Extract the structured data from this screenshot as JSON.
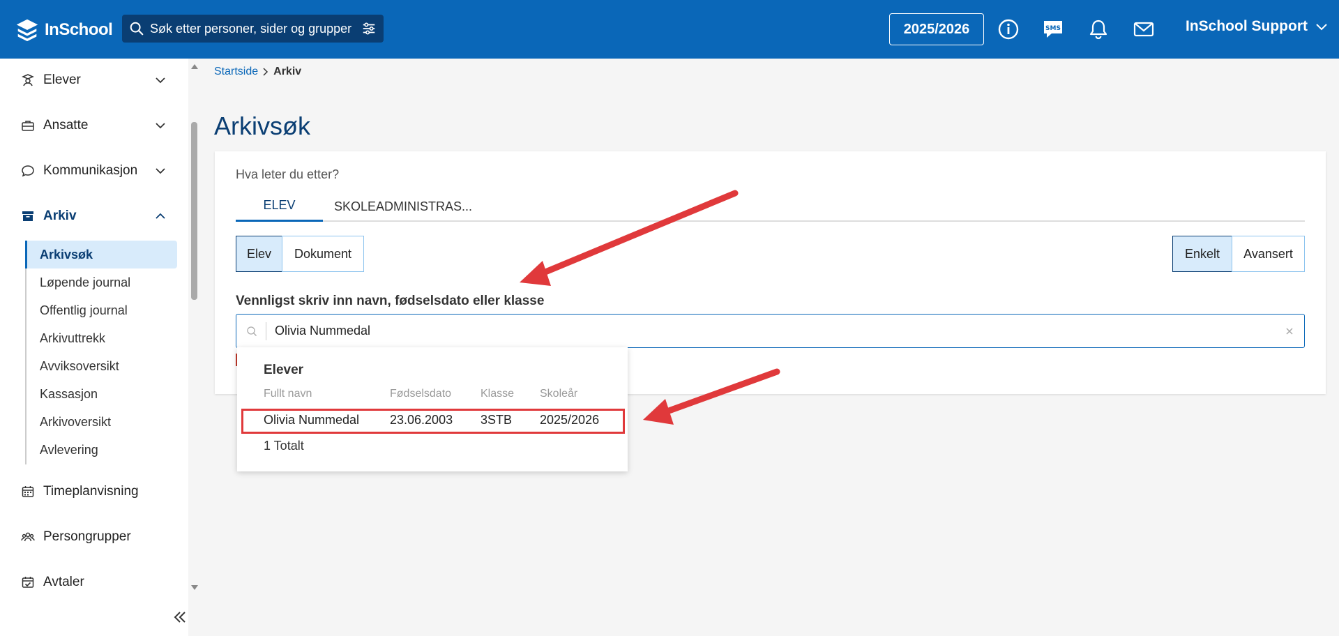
{
  "header": {
    "logo_text": "InSchool",
    "search_placeholder": "Søk etter personer, sider og grupper",
    "year": "2025/2026",
    "user_name": "InSchool Support",
    "icons": [
      "info-icon",
      "sms-icon",
      "bell-icon",
      "mail-icon"
    ]
  },
  "sidebar": {
    "items": [
      {
        "label": "Elever",
        "icon": "student-icon"
      },
      {
        "label": "Ansatte",
        "icon": "briefcase-icon"
      },
      {
        "label": "Kommunikasjon",
        "icon": "chat-icon"
      },
      {
        "label": "Arkiv",
        "icon": "archive-icon"
      },
      {
        "label": "Timeplanvisning",
        "icon": "calendar-icon"
      },
      {
        "label": "Persongrupper",
        "icon": "people-icon"
      },
      {
        "label": "Avtaler",
        "icon": "calendar-check-icon"
      }
    ],
    "sub_items": [
      "Arkivsøk",
      "Løpende journal",
      "Offentlig journal",
      "Arkivuttrekk",
      "Avviksoversikt",
      "Kassasjon",
      "Arkivoversikt",
      "Avlevering"
    ]
  },
  "breadcrumb": {
    "home": "Startside",
    "current": "Arkiv"
  },
  "page": {
    "title": "Arkivsøk",
    "question": "Hva leter du etter?",
    "tabs": [
      "ELEV",
      "SKOLEADMINISTRAS..."
    ],
    "segments_left": [
      "Elev",
      "Dokument"
    ],
    "segments_right": [
      "Enkelt",
      "Avansert"
    ],
    "field_label": "Vennligst skriv inn navn, fødselsdato eller klasse",
    "field_value": "Olivia Nummedal"
  },
  "dropdown": {
    "title": "Elever",
    "columns": [
      "Fullt navn",
      "Fødselsdato",
      "Klasse",
      "Skoleår"
    ],
    "rows": [
      [
        "Olivia Nummedal",
        "23.06.2003",
        "3STB",
        "2025/2026"
      ]
    ],
    "total": "1 Totalt"
  },
  "colors": {
    "header_bg": "#0a67b8",
    "accent_dark": "#0a3e73",
    "highlight": "#e0393b",
    "selected_bg": "#d8ebfb"
  }
}
